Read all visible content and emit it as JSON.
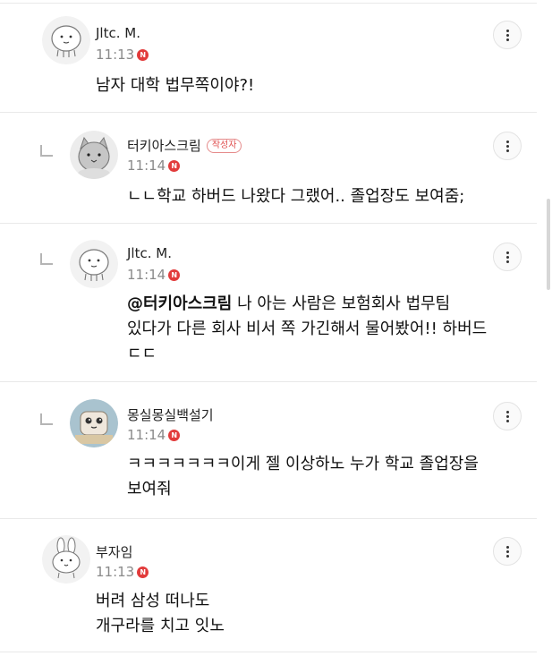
{
  "comments": [
    {
      "author": "Jltc. M.",
      "time": "11:13",
      "new_badge": "N",
      "is_reply": false,
      "avatar_icon": "cartoon-face-avatar",
      "lines": [
        "남자 대학 법무쪽이야?!"
      ]
    },
    {
      "author": "터키아스크림",
      "writer_badge": "작성자",
      "time": "11:14",
      "new_badge": "N",
      "is_reply": true,
      "avatar_icon": "cat-avatar",
      "lines": [
        "ㄴㄴ학교 하버드 나왔다 그랬어.. 졸업장도 보여줌;"
      ]
    },
    {
      "author": "Jltc. M.",
      "time": "11:14",
      "new_badge": "N",
      "is_reply": true,
      "avatar_icon": "cartoon-face-avatar",
      "mention": "@터키아스크림",
      "lines": [
        " 나 아는 사람은 보험회사 법무팀",
        "있다가 다른 회사 비서 쪽 가긴해서 물어봤어!! 하버드",
        "ㄷㄷ"
      ]
    },
    {
      "author": "몽실몽실백설기",
      "time": "11:14",
      "new_badge": "N",
      "is_reply": true,
      "avatar_icon": "toast-character-avatar",
      "lines": [
        "ㅋㅋㅋㅋㅋㅋㅋ이게 젤 이상하노 누가 학교 졸업장을",
        "보여줘"
      ]
    },
    {
      "author": "부자임",
      "time": "11:13",
      "new_badge": "N",
      "is_reply": false,
      "avatar_icon": "bunny-avatar",
      "lines": [
        "버려 삼성 떠나도",
        "개구라를 치고 잇노"
      ]
    }
  ],
  "icons": {
    "more": "more-vertical-icon",
    "reply": "reply-indent-icon"
  },
  "colors": {
    "new_badge": "#e23b3b",
    "writer_badge": "#e05050",
    "time": "#8a8a8a",
    "divider": "#e9e9e9"
  }
}
